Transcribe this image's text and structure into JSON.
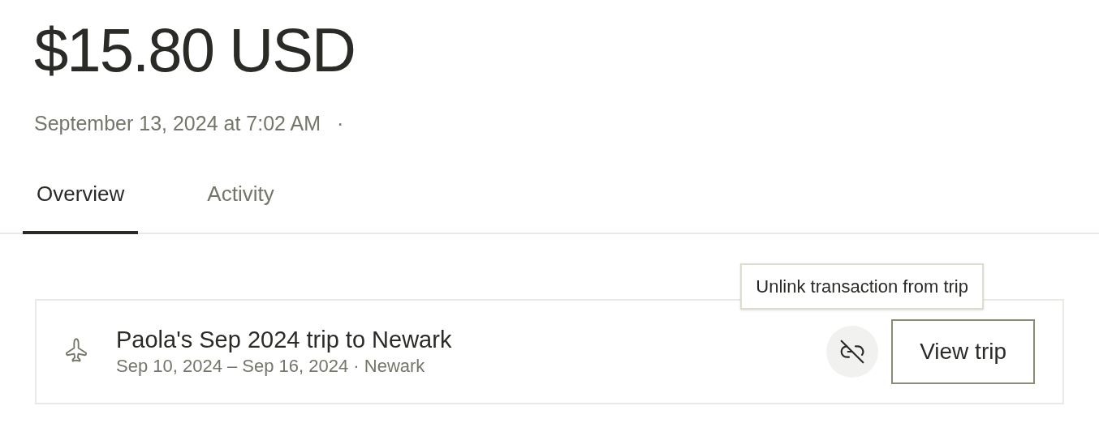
{
  "amount": "$15.80 USD",
  "timestamp": "September 13, 2024 at 7:02 AM",
  "separator": "·",
  "tabs": [
    {
      "label": "Overview",
      "selected": true
    },
    {
      "label": "Activity",
      "selected": false
    }
  ],
  "trip": {
    "title": "Paola's Sep 2024 trip to Newark",
    "details": "Sep 10, 2024 – Sep 16, 2024 · Newark",
    "tooltip": "Unlink transaction from trip",
    "button": "View trip"
  }
}
